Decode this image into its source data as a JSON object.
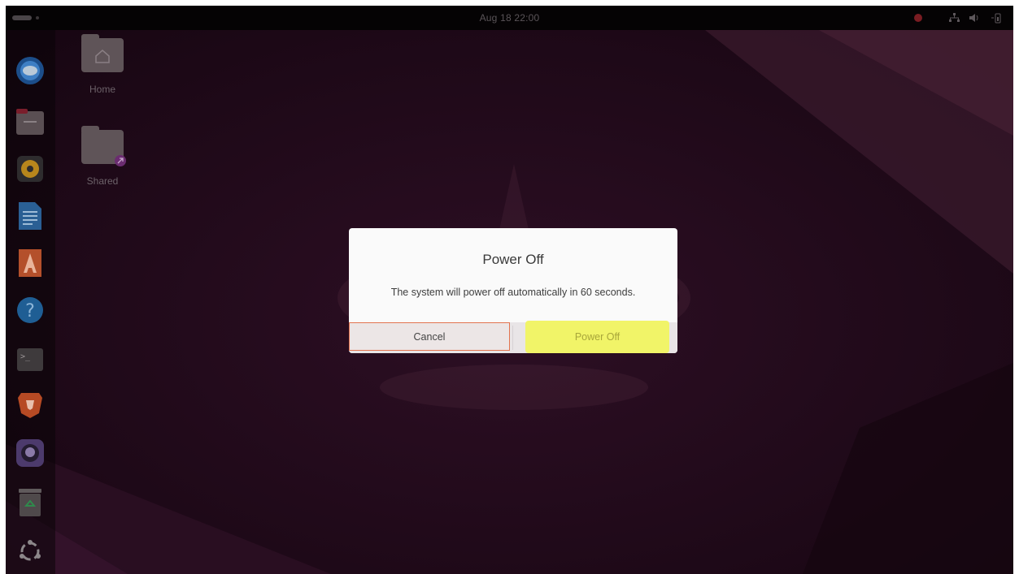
{
  "topbar": {
    "clock": "Aug 18  22:00"
  },
  "dock": {
    "items": [
      {
        "name": "thunderbird",
        "icon": "thunderbird-icon"
      },
      {
        "name": "files",
        "icon": "files-icon"
      },
      {
        "name": "rhythmbox",
        "icon": "rhythmbox-icon"
      },
      {
        "name": "writer",
        "icon": "libreoffice-writer-icon"
      },
      {
        "name": "app-center",
        "icon": "app-center-icon"
      },
      {
        "name": "help",
        "icon": "help-icon"
      },
      {
        "name": "terminal",
        "icon": "terminal-icon"
      },
      {
        "name": "brave",
        "icon": "brave-browser-icon"
      },
      {
        "name": "github-desktop",
        "icon": "github-icon"
      },
      {
        "name": "trash",
        "icon": "trash-icon"
      },
      {
        "name": "show-apps",
        "icon": "ubuntu-apps-icon"
      }
    ]
  },
  "desktop": {
    "home_label": "Home",
    "shared_label": "Shared"
  },
  "dialog": {
    "title": "Power Off",
    "message": "The system will power off automatically in 60 seconds.",
    "cancel_label": "Cancel",
    "power_off_label": "Power Off"
  },
  "colors": {
    "background": "#20091a",
    "dialog": "#fafafa",
    "highlight": "#f1f468",
    "focus_border": "#e2734f"
  }
}
